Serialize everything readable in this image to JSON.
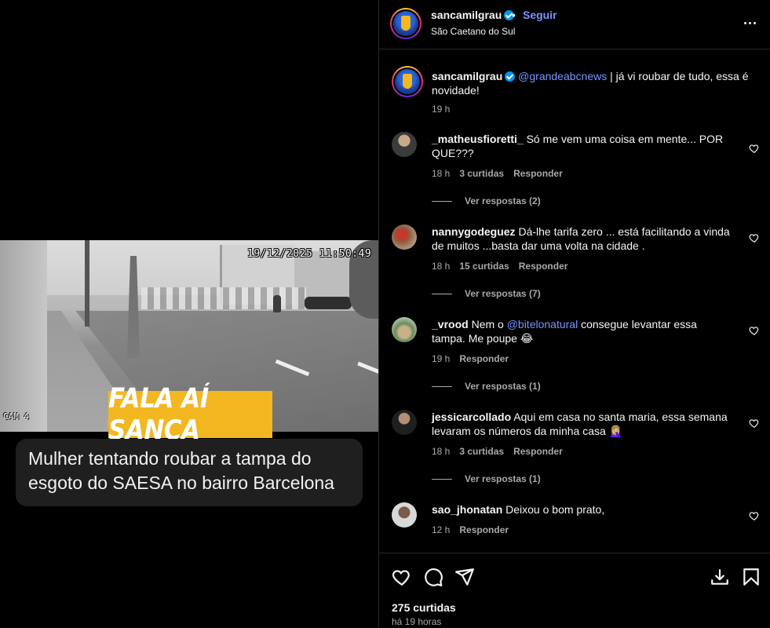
{
  "video": {
    "timestamp": "19/12/2025 11:50:49",
    "camera_label": "CAM 4",
    "brand_badge": "FALA AÍ SANCA",
    "caption_line1": "Mulher tentando roubar a tampa do",
    "caption_line2": "esgoto do SAESA no bairro Barcelona"
  },
  "header": {
    "username": "sancamilgrau",
    "separator": "•",
    "follow_label": "Seguir",
    "location": "São Caetano do Sul"
  },
  "caption": {
    "username": "sancamilgrau",
    "mention": "@grandeabcnews",
    "text": " | já vi roubar de tudo, essa é novidade!",
    "time": "19 h"
  },
  "comments": [
    {
      "username": "_matheusfioretti_",
      "text": " Só me vem uma coisa em mente... POR QUE???",
      "time": "18 h",
      "likes": "3 curtidas",
      "reply_label": "Responder",
      "replies_label": "Ver respostas (2)"
    },
    {
      "username": "nannygodeguez",
      "text": " Dá-lhe tarifa zero ... está facilitando a vinda de muitos ...basta dar uma volta na cidade .",
      "time": "18 h",
      "likes": "15 curtidas",
      "reply_label": "Responder",
      "replies_label": "Ver respostas (7)"
    },
    {
      "username": "_vrood",
      "text_before": " Nem o ",
      "mention": "@bitelonatural",
      "text_after": " consegue levantar essa tampa. Me poupe 😂",
      "time": "19 h",
      "reply_label": "Responder",
      "replies_label": "Ver respostas (1)"
    },
    {
      "username": "jessicarcollado",
      "text": " Aqui em casa no santa maria, essa semana levaram os números da minha casa 🤦🏼‍♀️",
      "time": "18 h",
      "likes": "3 curtidas",
      "reply_label": "Responder",
      "replies_label": "Ver respostas (1)"
    },
    {
      "username": "sao_jhonatan",
      "text": " Deixou o bom prato,",
      "time": "12 h",
      "reply_label": "Responder"
    }
  ],
  "footer": {
    "likes_count": "275 curtidas",
    "post_time": "há 19 horas"
  },
  "colors": {
    "accent_link": "#7a93ff",
    "verified": "#0095f6",
    "badge_yellow": "#f2b721",
    "muted_text": "#a8a8a8"
  },
  "icons": [
    "verified-icon",
    "more-options-icon",
    "heart-icon",
    "comment-icon",
    "share-icon",
    "download-icon",
    "bookmark-icon"
  ]
}
